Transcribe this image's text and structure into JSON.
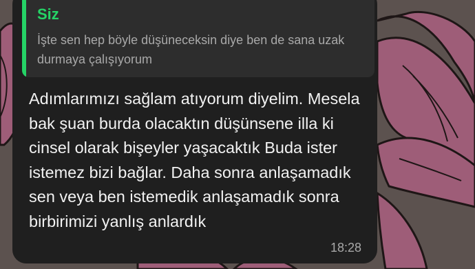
{
  "wallpaper": {
    "background_color": "#5c524f",
    "bow_color": "#9e5d78",
    "icon": "ribbon-bow-icon"
  },
  "quoted_message": {
    "author": "Siz",
    "text": "İşte sen hep böyle düşüneceksin diye ben de sana uzak durmaya çalışıyorum",
    "accent_color": "#25d366"
  },
  "message": {
    "text": "Adımlarımızı sağlam atıyorum diyelim. Mesela bak şuan burda olacaktın düşünsene illa ki cinsel olarak bişeyler yaşacaktık Buda ister istemez bizi bağlar. Daha sonra anlaşamadık sen veya ben istemedik anlaşamadık sonra birbirimizi yanlış anlardık",
    "time": "18:28",
    "bubble_color": "#1f1f1f"
  }
}
